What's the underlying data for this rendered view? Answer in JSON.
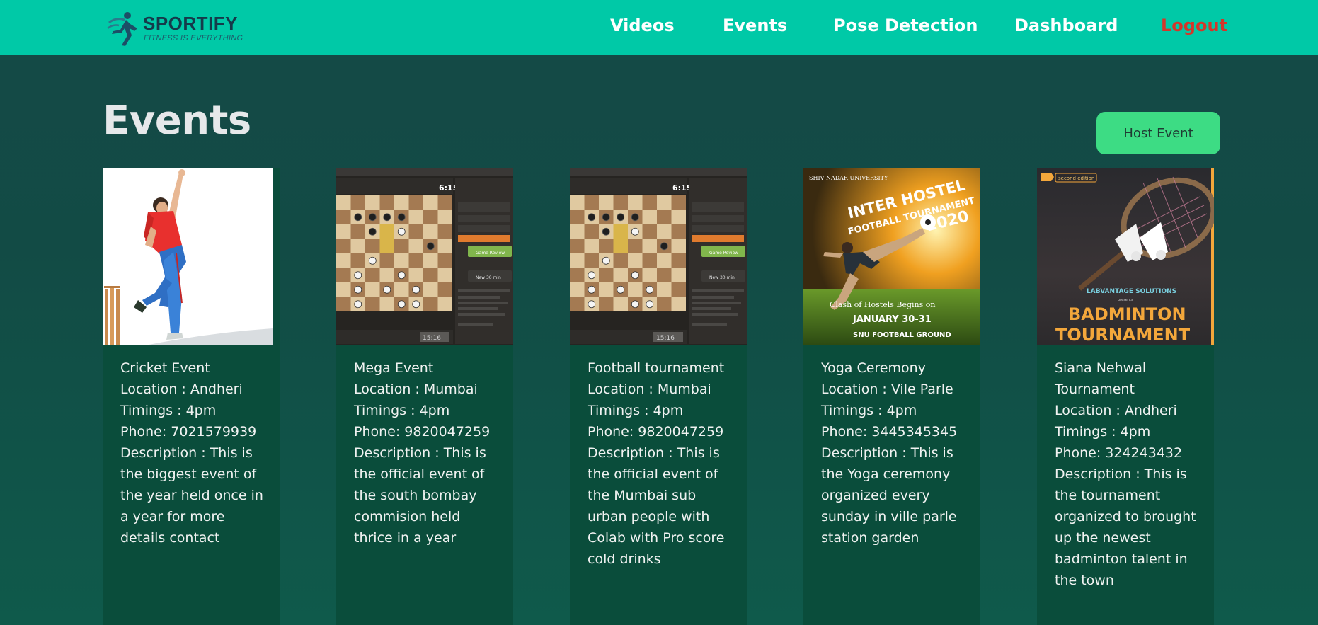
{
  "brand": {
    "name": "SPORTIFY",
    "tagline": "FITNESS IS EVERYTHING"
  },
  "nav": {
    "videos": "Videos",
    "events": "Events",
    "pose_detection": "Pose Detection",
    "dashboard": "Dashboard",
    "logout": "Logout"
  },
  "page": {
    "title": "Events",
    "host_button": "Host Event"
  },
  "colors": {
    "navbar": "#00c9a7",
    "logout": "#d4362a",
    "host_button": "#3ddc84",
    "card": "#0a4d3b"
  },
  "events": [
    {
      "name": "Cricket Event",
      "location": "Location : Andheri",
      "timings": "Timings : 4pm",
      "phone": "Phone: 7021579939",
      "description": "Description : This is the biggest event of the year held once in a year for more details contact",
      "image": "cricket-bowler-image"
    },
    {
      "name": "Mega Event",
      "location": "Location : Mumbai",
      "timings": "Timings : 4pm",
      "phone": "Phone: 9820047259",
      "description": "Description : This is the official event of the south bombay commision held thrice in a year",
      "image": "chess-board-screenshot",
      "screen_text": {
        "clock": "6:15",
        "bottom_clock": "15:16",
        "review": "Game Review",
        "new_game": "New 30 min"
      }
    },
    {
      "name": "Football tournament",
      "location": "Location : Mumbai",
      "timings": "Timings : 4pm",
      "phone": "Phone: 9820047259",
      "description": "Description : This is the official event of the Mumbai sub urban people with Colab with Pro score cold drinks",
      "image": "chess-board-screenshot",
      "screen_text": {
        "clock": "6:15",
        "bottom_clock": "15:16",
        "review": "Game Review",
        "new_game": "New 30 min"
      }
    },
    {
      "name": "Yoga Ceremony",
      "location": "Location : Vile Parle",
      "timings": "Timings : 4pm",
      "phone": "Phone: 3445345345",
      "description": "Description : This is the Yoga ceremony organized every sunday in ville parle station garden",
      "image": "football-poster",
      "poster": {
        "university": "SHIV NADAR UNIVERSITY",
        "line1": "INTER HOSTEL",
        "line2": "FOOTBALL TOURNAMENT",
        "year": "2020",
        "tagline": "Clash of Hostels Begins on",
        "dates": "JANUARY 30-31",
        "venue": "SNU FOOTBALL GROUND"
      }
    },
    {
      "name": "Siana Nehwal Tournament",
      "location": "Location : Andheri",
      "timings": "Timings : 4pm",
      "phone": "Phone: 324243432",
      "description": "Description : This is the tournament organized to brought up the newest badminton talent in the town",
      "image": "badminton-poster",
      "poster": {
        "edition": "second edition",
        "org": "LABVANTAGE SOLUTIONS",
        "presents": "presents",
        "title1": "BADMINTON",
        "title2": "TOURNAMENT"
      }
    }
  ]
}
